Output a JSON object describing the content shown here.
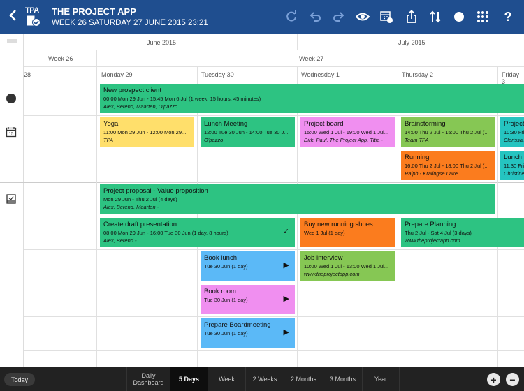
{
  "header": {
    "back_icon": "chevron-left-icon",
    "logo_text": "TPA",
    "title": "THE PROJECT APP",
    "subtitle": "WEEK 26  SATURDAY 27 JUNE 2015  23:21",
    "toolbar_icons": [
      "refresh-icon",
      "undo-icon",
      "redo-icon",
      "eye-icon",
      "calendar-view-icon",
      "share-icon",
      "sort-icon",
      "circle-icon",
      "grid-icon",
      "help-icon"
    ],
    "help_label": "?"
  },
  "months": {
    "june": "June 2015",
    "july": "July 2015"
  },
  "weeks": {
    "w26": "Week 26",
    "w27": "Week 27"
  },
  "days": {
    "d28": "28",
    "mon": "Monday 29",
    "tue": "Tuesday 30",
    "wed": "Wednesday 1",
    "thu": "Thursday 2",
    "fri": "Friday 3"
  },
  "rows": {
    "milestones_icon": "circle-icon",
    "appointments_icon": "calendar-icon",
    "tasks_icon": "task-icon"
  },
  "events": {
    "new_prospect": {
      "title": "New prospect client",
      "time": "00:00 Mon 29 Jun - 15:45 Mon 6 Jul (1 week, 15 hours, 45 minutes)",
      "people": "Alex, Berend, Maarten, O'pazzo"
    },
    "yoga": {
      "title": "Yoga",
      "time": "11:00 Mon 29 Jun - 12:00 Mon 29...",
      "people": "TPA"
    },
    "lunch_meeting": {
      "title": "Lunch Meeting",
      "time": "12:00 Tue 30 Jun - 14:00 Tue 30 J...",
      "people": "O'pazzo"
    },
    "project_board": {
      "title": "Project board",
      "time": "15:00 Wed 1 Jul - 19:00 Wed 1 Jul...",
      "people": "Dirk, Paul, The Project App, Titia -"
    },
    "brainstorming": {
      "title": "Brainstorming",
      "time": "14:00 Thu 2 Jul - 15:00 Thu 2 Jul (...",
      "people": "Team TPA"
    },
    "project_fri": {
      "title": "Project",
      "time": "10:30 Fri",
      "people": "Clarissa,"
    },
    "running": {
      "title": "Running",
      "time": "16:00 Thu 2 Jul - 18:00 Thu 2 Jul (...",
      "people": "Ralph - Kralingse Lake"
    },
    "lunch_fri": {
      "title": "Lunch",
      "time": "11:30 Fri",
      "people": "Christine"
    },
    "proposal": {
      "title": "Project proposal - Value proposition",
      "time": "Mon 29 Jun - Thu 2 Jul (4 days)",
      "people": "Alex, Berend, Maarten -"
    },
    "draft": {
      "title": "Create draft presentation",
      "time": "08:00 Mon 29 Jun - 16:00 Tue 30 Jun (1 day, 8 hours)",
      "people": "Alex, Berend -",
      "mark": "✓"
    },
    "shoes": {
      "title": "Buy new running shoes",
      "time": "Wed 1 Jul (1 day)"
    },
    "planning": {
      "title": "Prepare Planning",
      "time": "Thu 2 Jul - Sat 4 Jul (3 days)",
      "people": "www.theprojectapp.com"
    },
    "book_lunch": {
      "title": "Book lunch",
      "time": "Tue 30 Jun (1 day)",
      "mark": "▶"
    },
    "job_interview": {
      "title": "Job interview",
      "time": "10:00 Wed 1 Jul - 13:00 Wed 1 Jul...",
      "people": "www.theprojectapp.com"
    },
    "book_room": {
      "title": "Book room",
      "time": "Tue 30 Jun (1 day)",
      "mark": "▶"
    },
    "boardmeeting": {
      "title": "Prepare Boardmeeting",
      "time": "Tue 30 Jun (1 day)",
      "mark": "▶"
    }
  },
  "footer": {
    "today": "Today",
    "views": [
      "Daily Dashboard",
      "5 Days",
      "Week",
      "2 Weeks",
      "2 Months",
      "3 Months",
      "Year"
    ],
    "active_view": "5 Days",
    "add": "+",
    "remove": "−"
  }
}
